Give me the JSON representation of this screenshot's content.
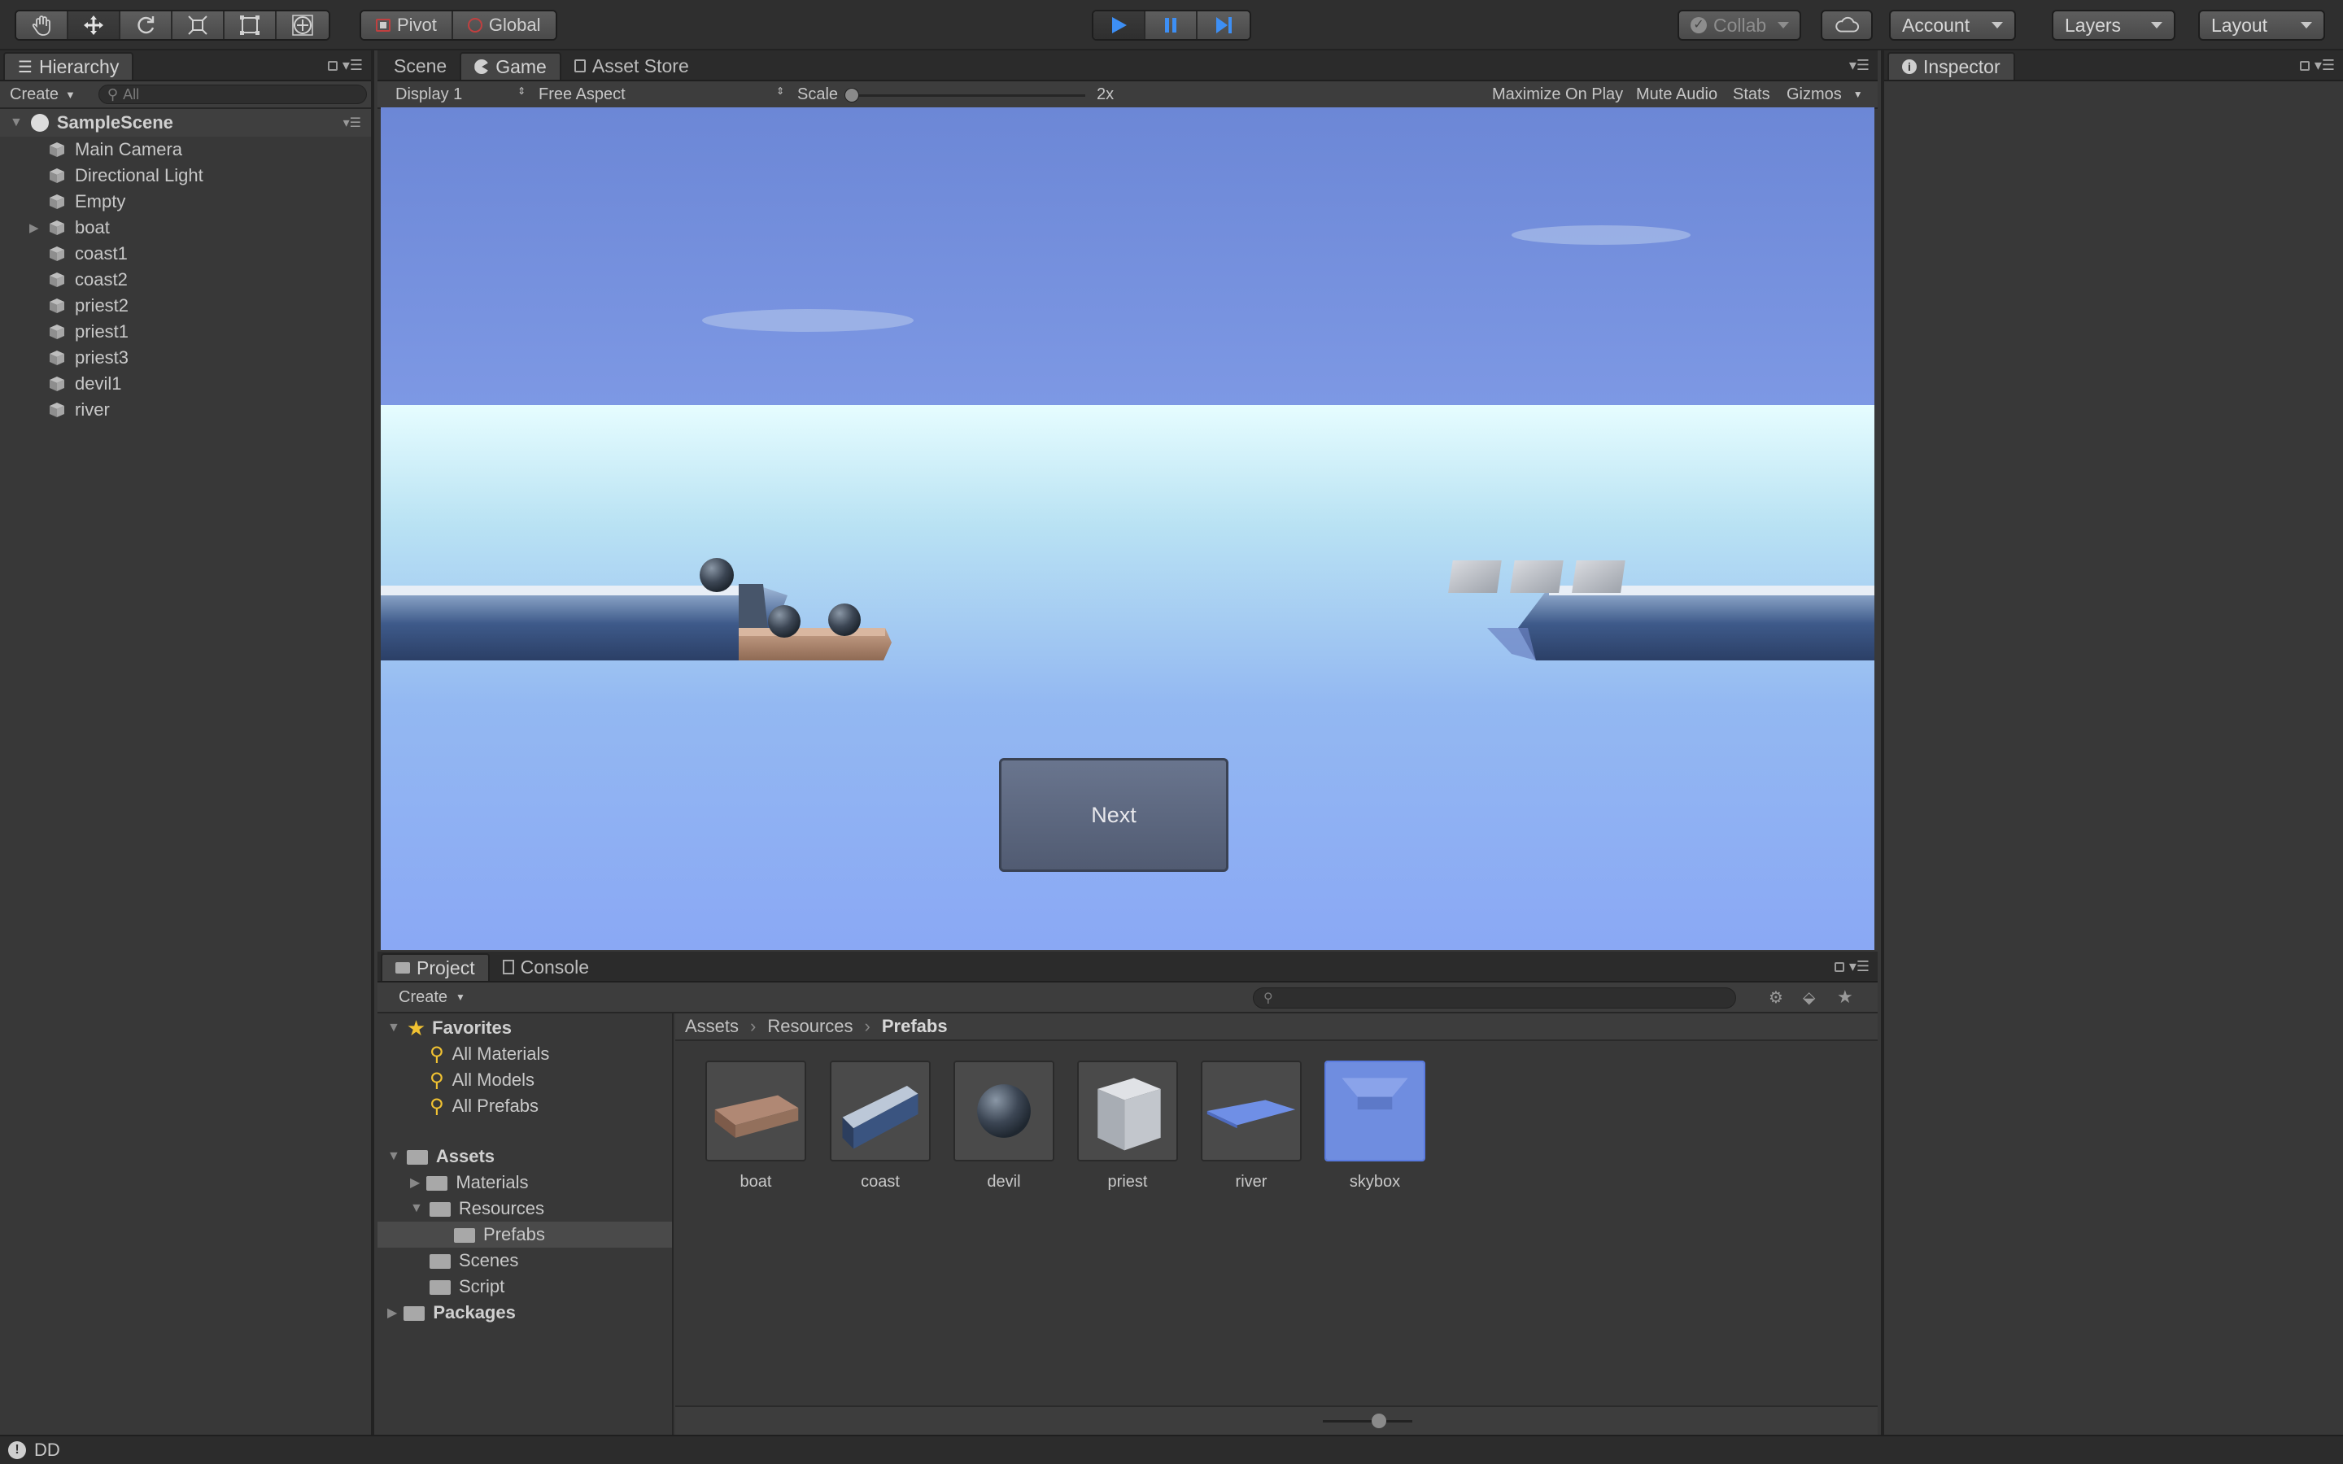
{
  "toolbar": {
    "tools": [
      "hand-icon",
      "move-icon",
      "rotate-icon",
      "scale-icon",
      "rect-icon",
      "transform-icon"
    ],
    "pivot_label": "Pivot",
    "global_label": "Global",
    "collab_label": "Collab",
    "account_label": "Account",
    "layers_label": "Layers",
    "layout_label": "Layout",
    "play_color": "#3d8ff5"
  },
  "hierarchy": {
    "tab_label": "Hierarchy",
    "create_label": "Create",
    "search_placeholder": "All",
    "scene_name": "SampleScene",
    "items": [
      "Main Camera",
      "Directional Light",
      "Empty",
      "boat",
      "coast1",
      "coast2",
      "priest2",
      "priest1",
      "priest3",
      "devil1",
      "river"
    ]
  },
  "center_tabs": {
    "scene_label": "Scene",
    "game_label": "Game",
    "store_label": "Asset Store"
  },
  "game_toolbar": {
    "display_label": "Display 1",
    "aspect_label": "Free Aspect",
    "scale_label": "Scale",
    "scale_value": "2x",
    "maximize_label": "Maximize On Play",
    "mute_label": "Mute Audio",
    "stats_label": "Stats",
    "gizmos_label": "Gizmos"
  },
  "game": {
    "next_button_label": "Next"
  },
  "inspector": {
    "tab_label": "Inspector"
  },
  "project": {
    "tab_label": "Project",
    "console_label": "Console",
    "create_label": "Create",
    "favorites_label": "Favorites",
    "favorites": [
      "All Materials",
      "All Models",
      "All Prefabs"
    ],
    "assets_label": "Assets",
    "materials_label": "Materials",
    "resources_label": "Resources",
    "prefabs_label": "Prefabs",
    "scenes_label": "Scenes",
    "script_label": "Script",
    "packages_label": "Packages",
    "breadcrumb": [
      "Assets",
      "Resources",
      "Prefabs"
    ],
    "prefabs": [
      "boat",
      "coast",
      "devil",
      "priest",
      "river",
      "skybox"
    ]
  },
  "status": {
    "text": "DD"
  }
}
